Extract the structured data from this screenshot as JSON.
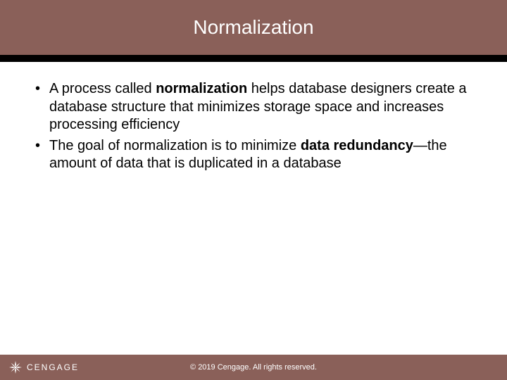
{
  "title": "Normalization",
  "bullets": [
    {
      "pre": "A process called ",
      "b1": "normalization",
      "mid": " helps database designers create a database structure that minimizes storage space and increases processing efficiency"
    },
    {
      "pre": "The goal of normalization is to minimize ",
      "b1": "data redundancy",
      "mid": "—the amount of data that is duplicated in a database"
    }
  ],
  "brand": "CENGAGE",
  "copyright": "© 2019 Cengage. All rights reserved."
}
